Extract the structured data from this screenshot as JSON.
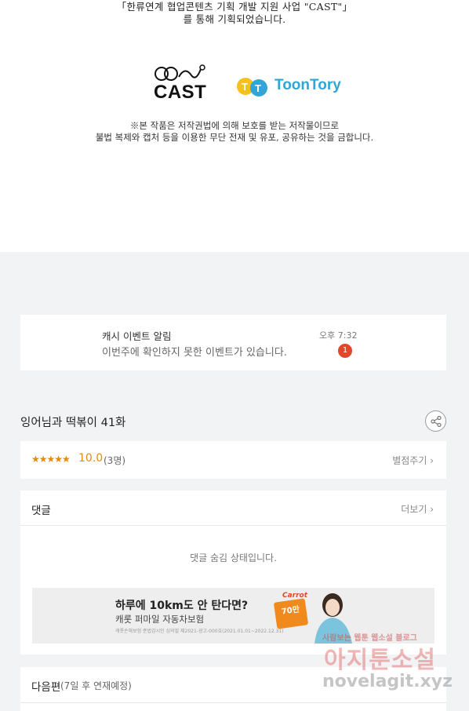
{
  "credits": {
    "line1": "「한류연계 협업콘텐츠 기획 개발 지원 사업 \"CAST\"」",
    "line2": "를 통해 기획되었습니다.",
    "logo_cast": "CAST",
    "logo_toontory": "ToonTory",
    "notice1": "※본 작품은 저작권법에 의해 보호를 받는 저작물이므로",
    "notice2": "불법 복제와 캡처 등을 이용한 무단 전재 및 유포, 공유하는 것을 금합니다."
  },
  "alert": {
    "title": "캐시 이벤트 알림",
    "message": "이번주에 확인하지 못한 이벤트가 있습니다.",
    "time": "오후 7:32",
    "badge_count": "1"
  },
  "episode": {
    "title": "잉어님과 떡볶이 41화",
    "share_icon": "share-icon"
  },
  "rating": {
    "stars": "★★★★★",
    "score": "10.0",
    "count": "(3명)",
    "rate_label": "별점주기 ›"
  },
  "comments": {
    "title": "댓글",
    "more_label": "더보기 ›",
    "hidden_message": "댓글 숨김 상태입니다."
  },
  "ad": {
    "headline": "하루에 10km도 안 탄다면?",
    "subline": "캐롯 퍼마일 자동차보험",
    "fine_print": "캐롯손해보험 준법감시인 심의필 제2021-광고-000호(2021.01.01~2022.12.31)",
    "brand": "Carrot",
    "tag": "70만"
  },
  "next": {
    "title": "다음편",
    "subtitle": "(7일 후 연재예정)"
  },
  "watermark": {
    "line1": "사람보는 웹툰 웹소설 블로그",
    "line2": "아지툰소설",
    "line3": "novelagit.xyz"
  },
  "colors": {
    "accent_orange": "#e58a11",
    "badge_red": "#e2472b",
    "toontory_blue": "#2fa6d8",
    "background": "#f2f3f5"
  }
}
